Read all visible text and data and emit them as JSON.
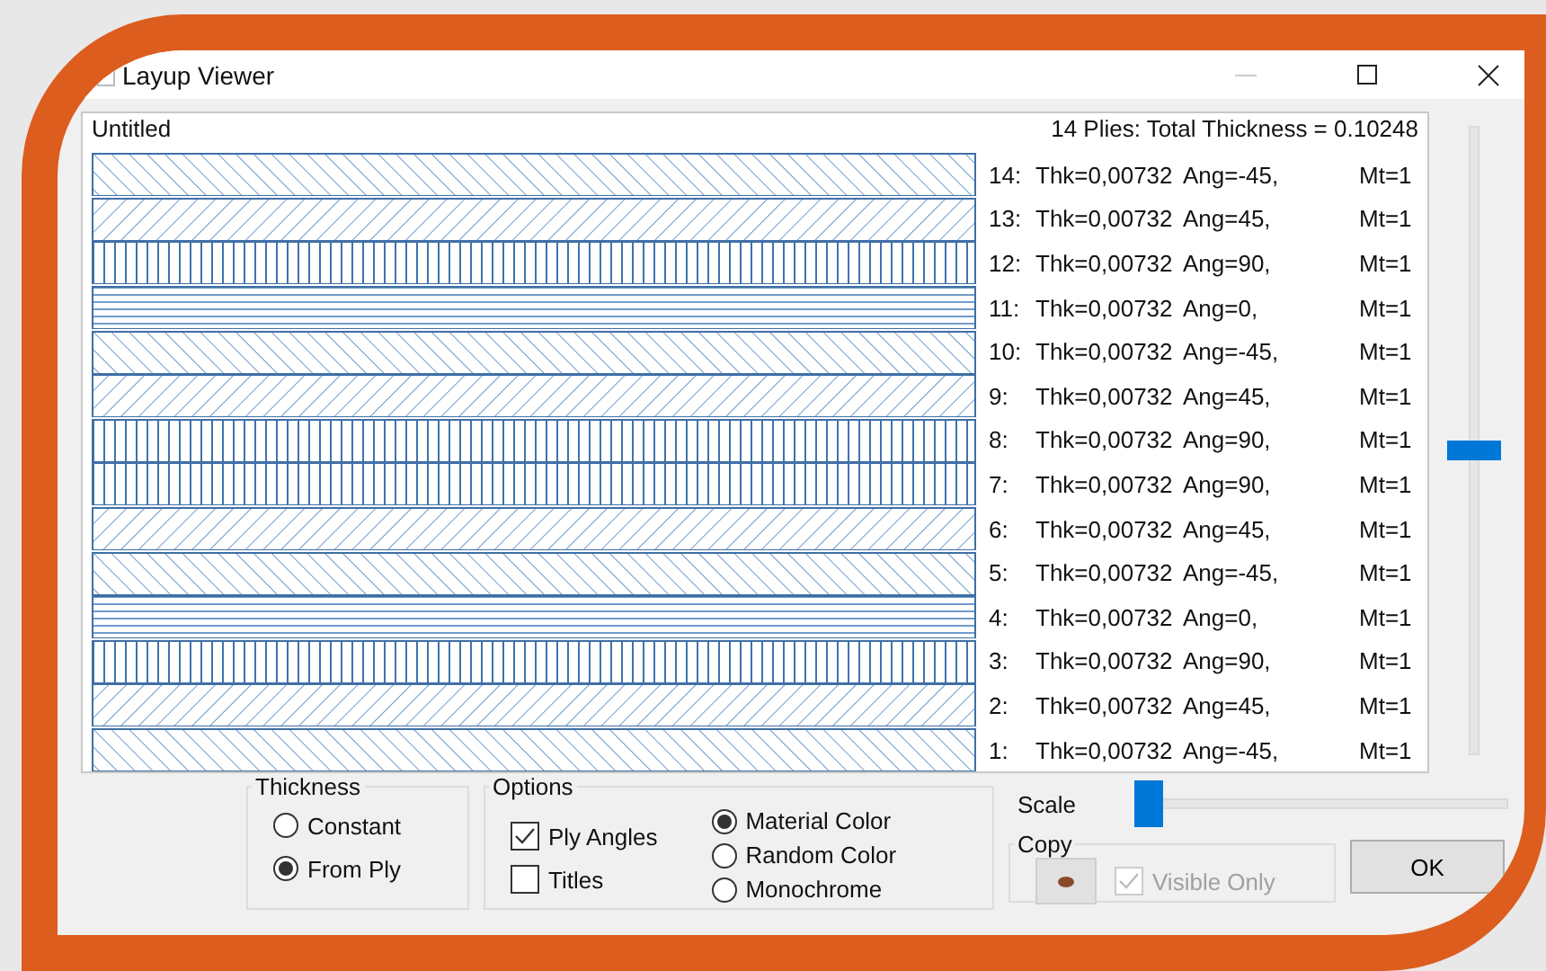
{
  "window": {
    "title": "Layup Viewer",
    "minimize_disabled": true
  },
  "panel": {
    "title": "Untitled",
    "summary": "14 Plies: Total Thickness = 0.10248"
  },
  "plies": [
    {
      "index": "14:",
      "thk": "Thk=0,00732",
      "ang": "Ang=-45,",
      "mt": "Mt=1",
      "kind": "backslash"
    },
    {
      "index": "13:",
      "thk": "Thk=0,00732",
      "ang": "Ang=45,",
      "mt": "Mt=1",
      "kind": "slash"
    },
    {
      "index": "12:",
      "thk": "Thk=0,00732",
      "ang": "Ang=90,",
      "mt": "Mt=1",
      "kind": "vertical"
    },
    {
      "index": "11:",
      "thk": "Thk=0,00732",
      "ang": "Ang=0,",
      "mt": "Mt=1",
      "kind": "horizontal"
    },
    {
      "index": "10:",
      "thk": "Thk=0,00732",
      "ang": "Ang=-45,",
      "mt": "Mt=1",
      "kind": "backslash"
    },
    {
      "index": "9:",
      "thk": "Thk=0,00732",
      "ang": "Ang=45,",
      "mt": "Mt=1",
      "kind": "slash"
    },
    {
      "index": "8:",
      "thk": "Thk=0,00732",
      "ang": "Ang=90,",
      "mt": "Mt=1",
      "kind": "vertical"
    },
    {
      "index": "7:",
      "thk": "Thk=0,00732",
      "ang": "Ang=90,",
      "mt": "Mt=1",
      "kind": "vertical"
    },
    {
      "index": "6:",
      "thk": "Thk=0,00732",
      "ang": "Ang=45,",
      "mt": "Mt=1",
      "kind": "slash"
    },
    {
      "index": "5:",
      "thk": "Thk=0,00732",
      "ang": "Ang=-45,",
      "mt": "Mt=1",
      "kind": "backslash"
    },
    {
      "index": "4:",
      "thk": "Thk=0,00732",
      "ang": "Ang=0,",
      "mt": "Mt=1",
      "kind": "horizontal"
    },
    {
      "index": "3:",
      "thk": "Thk=0,00732",
      "ang": "Ang=90,",
      "mt": "Mt=1",
      "kind": "vertical"
    },
    {
      "index": "2:",
      "thk": "Thk=0,00732",
      "ang": "Ang=45,",
      "mt": "Mt=1",
      "kind": "slash"
    },
    {
      "index": "1:",
      "thk": "Thk=0,00732",
      "ang": "Ang=-45,",
      "mt": "Mt=1",
      "kind": "backslash"
    }
  ],
  "vertical_slider": {
    "level": 0.5
  },
  "thickness": {
    "title": "Thickness",
    "options": [
      {
        "label": "Constant",
        "selected": false
      },
      {
        "label": "From Ply",
        "selected": true
      }
    ]
  },
  "options": {
    "title": "Options",
    "checkboxes": [
      {
        "label": "Ply Angles",
        "checked": true
      },
      {
        "label": "Titles",
        "checked": false
      }
    ],
    "colors": [
      {
        "label": "Material Color",
        "selected": true
      },
      {
        "label": "Random Color",
        "selected": false
      },
      {
        "label": "Monochrome",
        "selected": false
      }
    ]
  },
  "scale": {
    "label": "Scale",
    "level": 0
  },
  "copy": {
    "title": "Copy",
    "visible_only": {
      "label": "Visible Only",
      "checked": true,
      "disabled": true
    }
  },
  "ok_button": "OK"
}
